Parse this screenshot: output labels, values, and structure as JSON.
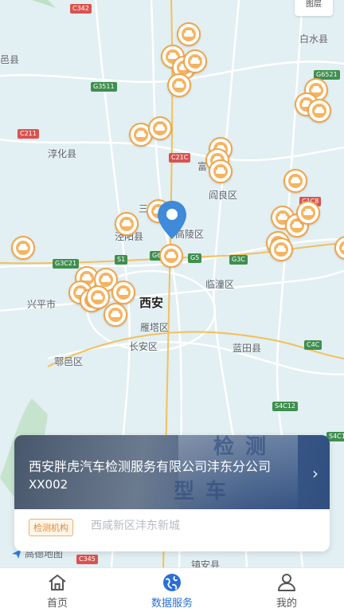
{
  "map": {
    "layers_label": "图层",
    "places": [
      {
        "id": "baishui",
        "text": "白水县"
      },
      {
        "id": "yixian",
        "text": "邑县"
      },
      {
        "id": "chunhua",
        "text": "淳化县"
      },
      {
        "id": "fu",
        "text": "富"
      },
      {
        "id": "yanliang",
        "text": "阎良区"
      },
      {
        "id": "san",
        "text": "三"
      },
      {
        "id": "jingyang",
        "text": "泾阳县"
      },
      {
        "id": "gaoling",
        "text": "高陵区"
      },
      {
        "id": "xingping",
        "text": "兴平市"
      },
      {
        "id": "xian",
        "text": "西安"
      },
      {
        "id": "lintong",
        "text": "临潼区"
      },
      {
        "id": "yanta",
        "text": "雁塔区"
      },
      {
        "id": "changan",
        "text": "长安区"
      },
      {
        "id": "huyi",
        "text": "鄠邑区"
      },
      {
        "id": "lantian",
        "text": "蓝田县"
      },
      {
        "id": "zhenan",
        "text": "镇安县"
      }
    ],
    "road_tags": [
      {
        "id": "c342",
        "text": "C342"
      },
      {
        "id": "g6521",
        "text": "G6521"
      },
      {
        "id": "g3511",
        "text": "G3511"
      },
      {
        "id": "c211",
        "text": "C211"
      },
      {
        "id": "c210",
        "text": "C21C"
      },
      {
        "id": "c108",
        "text": "C1C8"
      },
      {
        "id": "g3021",
        "text": "G3C21"
      },
      {
        "id": "s1",
        "text": "S1"
      },
      {
        "id": "g5",
        "text": "G5"
      },
      {
        "id": "g30",
        "text": "G3C"
      },
      {
        "id": "g40",
        "text": "C4C"
      },
      {
        "id": "s4012",
        "text": "S4C12"
      },
      {
        "id": "s401",
        "text": "S4C1"
      },
      {
        "id": "g6x",
        "text": "G6"
      },
      {
        "id": "c345",
        "text": "C345"
      }
    ],
    "logo_text": "高德地图"
  },
  "card": {
    "title": "西安胖虎汽车检测服务有限公司沣东分公司",
    "code": "XX002",
    "badge": "检测机构",
    "address": "西咸新区沣东新城",
    "photo_text": [
      "检",
      "测",
      "型",
      "车"
    ]
  },
  "tabs": [
    {
      "label": "首页",
      "icon": "home-icon"
    },
    {
      "label": "数据服务",
      "icon": "globe-icon"
    },
    {
      "label": "我的",
      "icon": "user-icon"
    }
  ],
  "colors": {
    "accent": "#2b6fd6",
    "pin_border": "#f0a54a",
    "badge": "#e8892b"
  }
}
